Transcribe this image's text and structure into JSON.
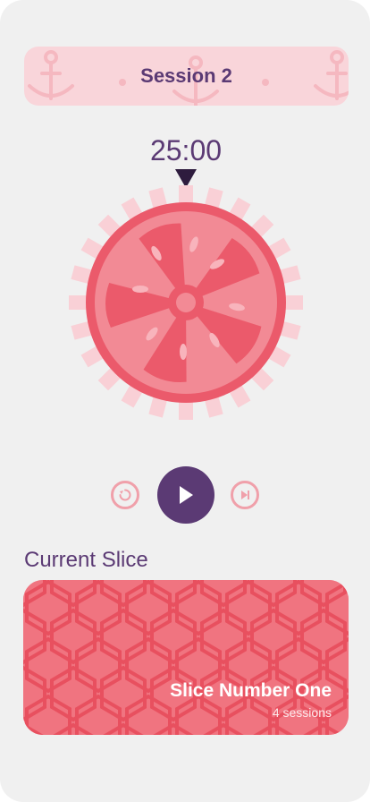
{
  "session": {
    "title": "Session 2"
  },
  "timer": {
    "display": "25:00"
  },
  "controls": {
    "reset_icon": "reset-icon",
    "play_icon": "play-icon",
    "skip_icon": "skip-forward-icon"
  },
  "current_slice": {
    "section_label": "Current Slice",
    "name": "Slice Number One",
    "sessions": "4 sessions"
  },
  "colors": {
    "primary": "#5b3a74",
    "tomato": "#eb5a6b",
    "tomato_light": "#f6a2ab",
    "banner": "#f9d5da",
    "background": "#f0f0f0"
  }
}
